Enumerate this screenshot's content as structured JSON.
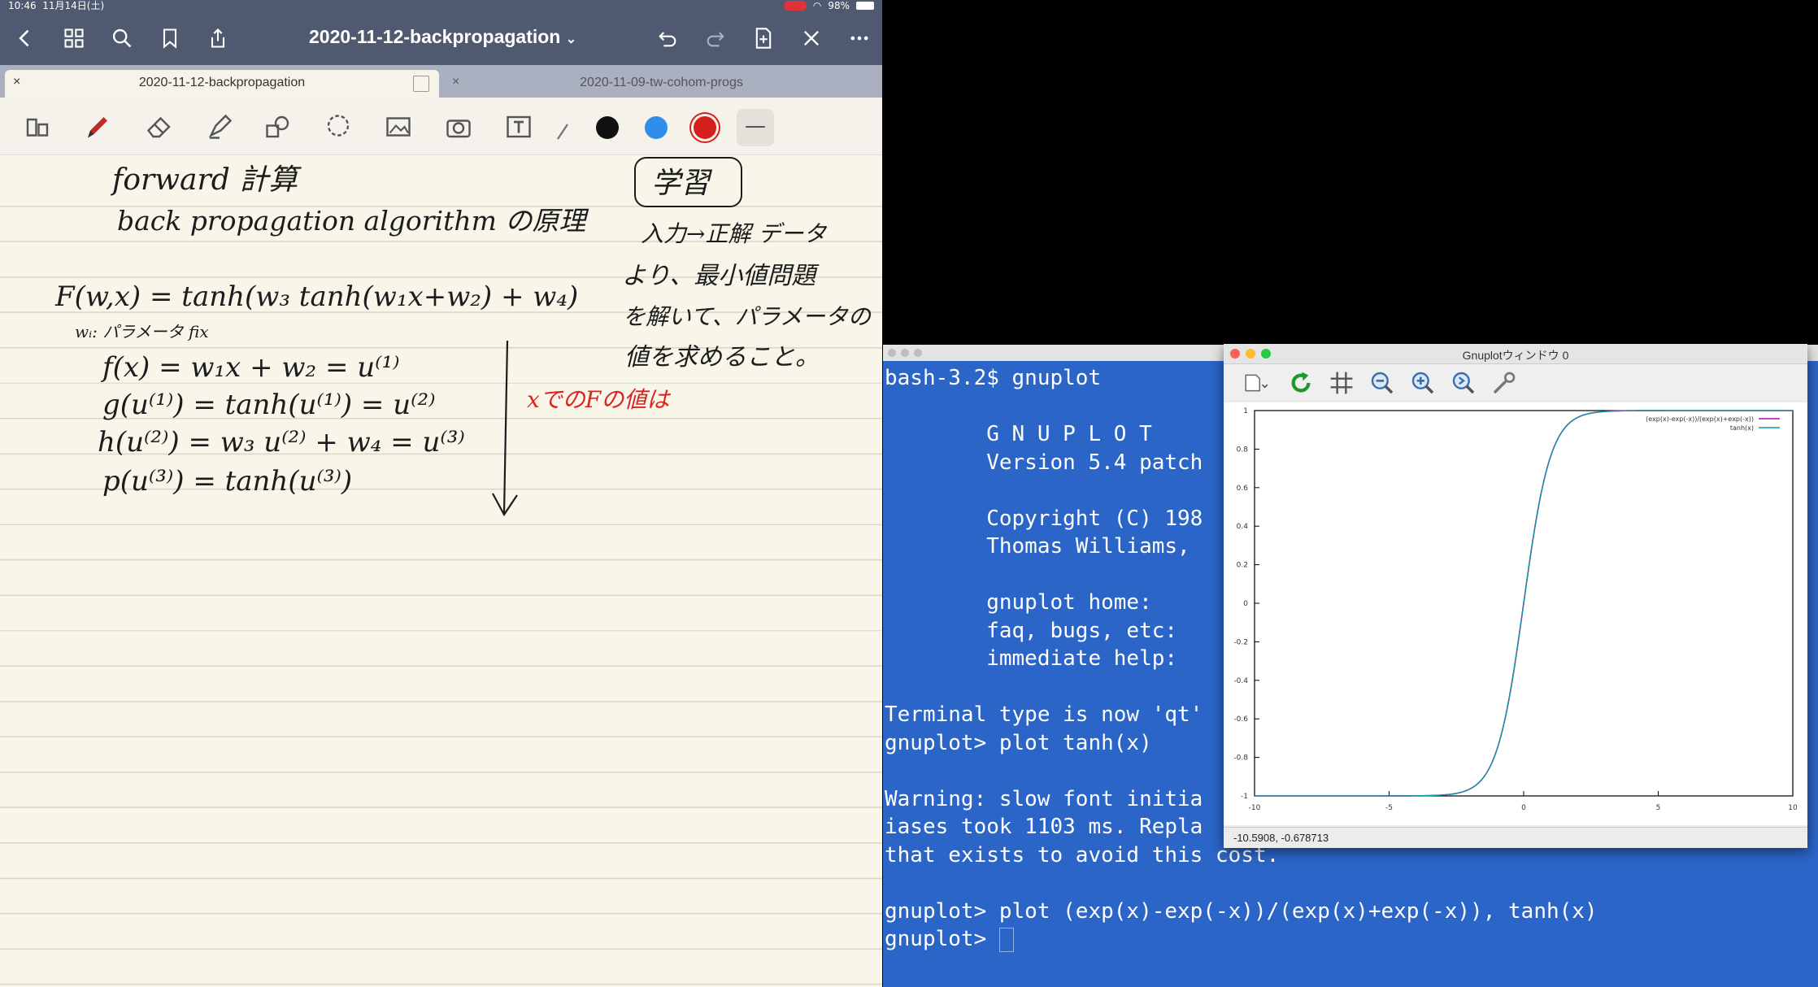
{
  "ipad": {
    "status": {
      "time": "10:46",
      "date": "11月14日(土)",
      "battery": "98%"
    },
    "nav": {
      "title": "2020-11-12-backpropagation",
      "title_caret": "⌄"
    },
    "tabs": [
      {
        "label": "2020-11-12-backpropagation",
        "close": "×",
        "active": true
      },
      {
        "label": "2020-11-09-tw-cohom-progs",
        "close": "×",
        "active": false
      }
    ],
    "colors": {
      "black": "#111111",
      "blue": "#2f8fe8",
      "red": "#d51f1f"
    },
    "notes": {
      "line1": "forward 計算",
      "line2": "back propagation algorithm の原理",
      "box": "学習",
      "side1": "入力→正解 データ",
      "side2": "より、最小値問題",
      "side3": "を解いて、パラメータの",
      "side4": "値を求めること。",
      "eq_F": "F(w,x) = tanh(w₃ tanh(w₁x+w₂) + w₄)",
      "eq_fix": "wᵢ: パラメータ fix",
      "eq_f": "f(x) = w₁x + w₂ = u⁽¹⁾",
      "eq_g": "g(u⁽¹⁾) = tanh(u⁽¹⁾) = u⁽²⁾",
      "eq_h": "h(u⁽²⁾) = w₃ u⁽²⁾ + w₄ = u⁽³⁾",
      "eq_p": "p(u⁽³⁾) = tanh(u⁽³⁾)",
      "red_note": "xでのFの値は"
    }
  },
  "terminal": {
    "lines": [
      "bash-3.2$ gnuplot",
      "",
      "        G N U P L O T",
      "        Version 5.4 patch",
      "",
      "        Copyright (C) 198",
      "        Thomas Williams,",
      "",
      "        gnuplot home:",
      "        faq, bugs, etc:",
      "        immediate help:",
      "",
      "Terminal type is now 'qt'",
      "gnuplot> plot tanh(x)",
      "",
      "Warning: slow font initia",
      "iases took 1103 ms. Repla",
      "that exists to avoid this cost.",
      "",
      "gnuplot> plot (exp(x)-exp(-x))/(exp(x)+exp(-x)), tanh(x)",
      "gnuplot> "
    ]
  },
  "gnuplot": {
    "title": "Gnuplotウィンドウ 0",
    "status": "-10.5908, -0.678713",
    "chart_data": {
      "type": "line",
      "xlim": [
        -10,
        10
      ],
      "ylim": [
        -1,
        1
      ],
      "xticks": [
        "-10",
        "-5",
        "0",
        "5",
        "10"
      ],
      "yticks": [
        "1",
        "0.8",
        "0.6",
        "0.4",
        "0.2",
        "0",
        "-0.2",
        "-0.4",
        "-0.6",
        "-0.8",
        "-1"
      ],
      "series": [
        {
          "name": "(exp(x)-exp(-x))/(exp(x)+exp(-x))",
          "function": "tanh",
          "color": "#c000c0"
        },
        {
          "name": "tanh(x)",
          "function": "tanh",
          "color": "#009e9e"
        }
      ]
    }
  }
}
